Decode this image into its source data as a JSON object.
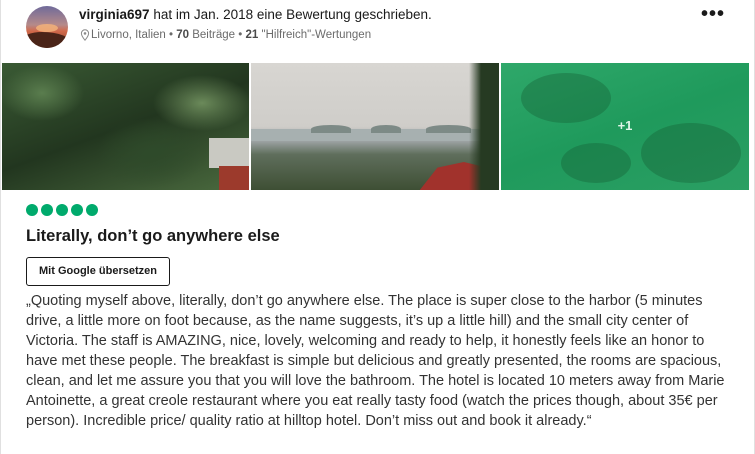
{
  "review": {
    "username": "virginia697",
    "action_text": "hat im Jan. 2018 eine Bewertung geschrieben.",
    "location": "Livorno, Italien",
    "contributions_count": "70",
    "contributions_label": "Beiträge",
    "helpful_count": "21",
    "helpful_label": "\"Hilfreich\"-Wertungen",
    "separator": "•",
    "more_options": "•••",
    "photos_extra": "+1",
    "rating": 5,
    "title": "Literally, don’t go anywhere else",
    "translate_label": "Mit Google übersetzen",
    "body": "„Quoting myself above, literally, don’t go anywhere else. The place is super close to the harbor (5 minutes drive, a little more on foot because, as the name suggests, it’s up a little hill) and the small city center of Victoria. The staff is AMAZING, nice, lovely, welcoming and ready to help, it honestly feels like an honor to have met these people. The breakfast is simple but delicious and greatly presented, the rooms are spacious, clean, and let me assure you that you will love the bathroom. The hotel is located 10 meters away from Marie Antoinette, a great creole restaurant where you eat really tasty food (watch the prices though, about 35€ per person). Incredible price/ quality ratio at hilltop hotel. Don’t miss out and book it already.“"
  },
  "colors": {
    "rating_bubble": "#00aa6c",
    "photo_overlay": "#1f9a5c"
  },
  "icons": {
    "location": "map-pin-icon",
    "more": "more-options-icon"
  }
}
